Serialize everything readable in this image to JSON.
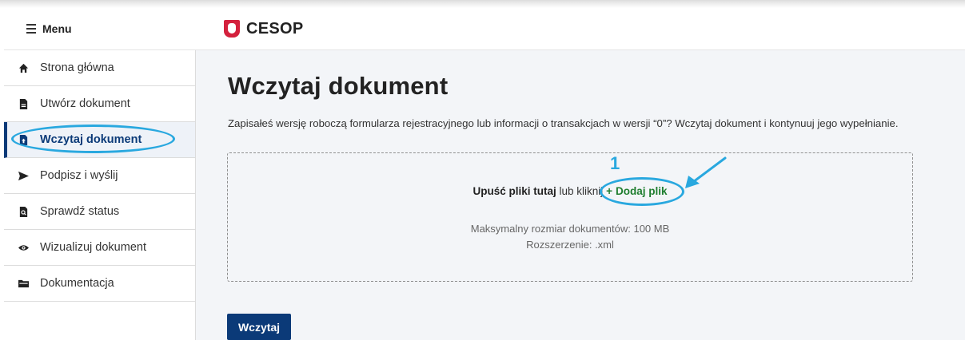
{
  "header": {
    "menu_label": "Menu",
    "brand_name": "CESOP"
  },
  "sidebar": {
    "items": [
      {
        "label": "Strona główna",
        "icon": "home-icon",
        "active": false
      },
      {
        "label": "Utwórz dokument",
        "icon": "document-icon",
        "active": false
      },
      {
        "label": "Wczytaj dokument",
        "icon": "upload-document-icon",
        "active": true
      },
      {
        "label": "Podpisz i wyślij",
        "icon": "send-icon",
        "active": false
      },
      {
        "label": "Sprawdź status",
        "icon": "search-document-icon",
        "active": false
      },
      {
        "label": "Wizualizuj dokument",
        "icon": "eye-icon",
        "active": false
      },
      {
        "label": "Dokumentacja",
        "icon": "folder-icon",
        "active": false
      }
    ]
  },
  "main": {
    "title": "Wczytaj dokument",
    "intro": "Zapisałeś wersję roboczą formularza rejestracyjnego lub informacji o transakcjach w wersji “0”? Wczytaj dokument i kontynuuj jego wypełnianie.",
    "dropzone": {
      "drop_strong": "Upuść pliki tutaj",
      "drop_or": " lub kliknij ",
      "add_plus": "+",
      "add_label": "Dodaj plik",
      "max_size": "Maksymalny rozmiar dokumentów: 100 MB",
      "extension": "Rozszerzenie: .xml",
      "step_number": "1"
    },
    "submit_label": "Wczytaj"
  },
  "colors": {
    "primary": "#0b3a78",
    "annotation": "#29a8df",
    "add_link": "#1e7d2e",
    "emblem": "#d4213d"
  }
}
